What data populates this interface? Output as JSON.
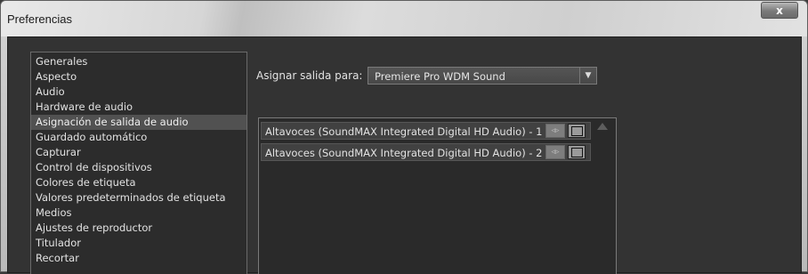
{
  "window": {
    "title": "Preferencias",
    "close_glyph": "x"
  },
  "sidebar": {
    "items": [
      {
        "label": "Generales"
      },
      {
        "label": "Aspecto"
      },
      {
        "label": "Audio"
      },
      {
        "label": "Hardware de audio"
      },
      {
        "label": "Asignación de salida de audio"
      },
      {
        "label": "Guardado automático"
      },
      {
        "label": "Capturar"
      },
      {
        "label": "Control de dispositivos"
      },
      {
        "label": "Colores de etiqueta"
      },
      {
        "label": "Valores predeterminados de etiqueta"
      },
      {
        "label": "Medios"
      },
      {
        "label": "Ajustes de reproductor"
      },
      {
        "label": "Titulador"
      },
      {
        "label": "Recortar"
      }
    ],
    "selected_index": 4
  },
  "main": {
    "assign_label": "Asignar salida para:",
    "output_select": {
      "value": "Premiere Pro WDM Sound",
      "arrow_icon": "chevron-down-icon"
    },
    "channels": [
      {
        "label": "Altavoces (SoundMAX Integrated Digital HD Audio) - 1",
        "speaker_icon": "stereo-speaker-icon",
        "frame_icon": "frame-icon"
      },
      {
        "label": "Altavoces (SoundMAX Integrated Digital HD Audio) - 2",
        "speaker_icon": "stereo-speaker-icon",
        "frame_icon": "frame-icon"
      }
    ]
  }
}
